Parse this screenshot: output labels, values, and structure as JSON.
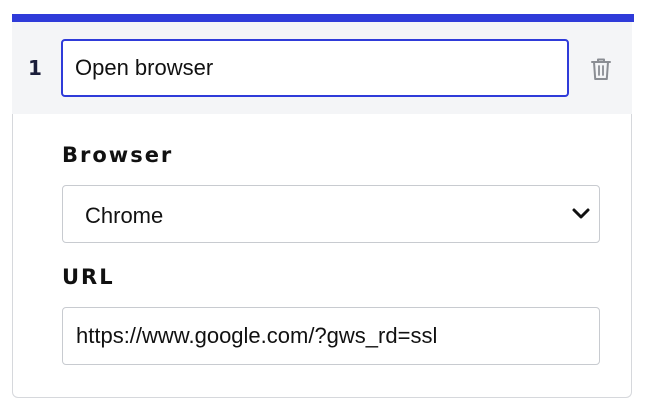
{
  "step": {
    "number": "1",
    "name_value": "Open browser"
  },
  "fields": {
    "browser": {
      "label": "Browser",
      "selected": "Chrome"
    },
    "url": {
      "label": "URL",
      "value": "https://www.google.com/?gws_rd=ssl"
    }
  },
  "icons": {
    "delete": "trash-icon",
    "dropdown": "chevron-down-icon"
  },
  "colors": {
    "accent": "#2f3bd9",
    "header_bg": "#f4f5f7",
    "border": "#c8cbd0",
    "icon_gray": "#8a8d93"
  }
}
